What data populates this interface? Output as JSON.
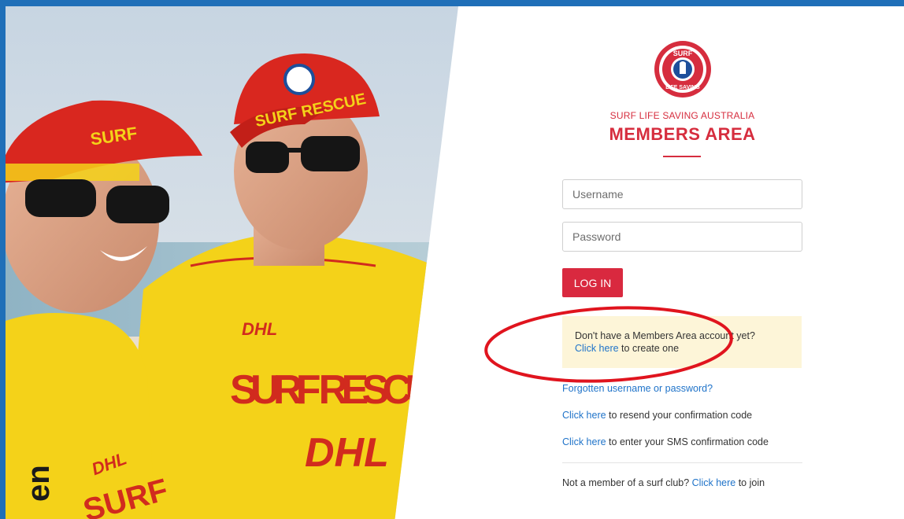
{
  "photo": {
    "cap_left_text": "SURF",
    "cap_right_text": "SURF RESCUE",
    "shirt_sponsor": "DHL",
    "shirt_text": "SURF RESCU",
    "shirt_sponsor_large": "DHL",
    "left_shirt_sponsor": "DHL",
    "left_shirt_text": "SURF",
    "sleeve_text": "en"
  },
  "brand": {
    "logo_text_top": "SURF",
    "logo_text_bottom": "LIFE SAVING",
    "org_name": "SURF LIFE SAVING AUSTRALIA",
    "area_title": "MEMBERS AREA"
  },
  "login": {
    "username_placeholder": "Username",
    "password_placeholder": "Password",
    "login_label": "LOG IN"
  },
  "notice": {
    "text": "Don't have a Members Area account yet?",
    "link": "Click here",
    "suffix": " to create one"
  },
  "links": {
    "forgot": "Forgotten username or password?",
    "resend_link": "Click here",
    "resend_suffix": " to resend your confirmation code",
    "sms_link": "Click here",
    "sms_suffix": " to enter your SMS confirmation code",
    "join_prefix": "Not a member of a surf club? ",
    "join_link": "Click here",
    "join_suffix": " to join"
  },
  "colors": {
    "frame": "#1f6fb8",
    "brand_red": "#d62d3e",
    "link_blue": "#1f73c9",
    "notice_bg": "#fdf5d8",
    "annotation": "#e0141e"
  }
}
